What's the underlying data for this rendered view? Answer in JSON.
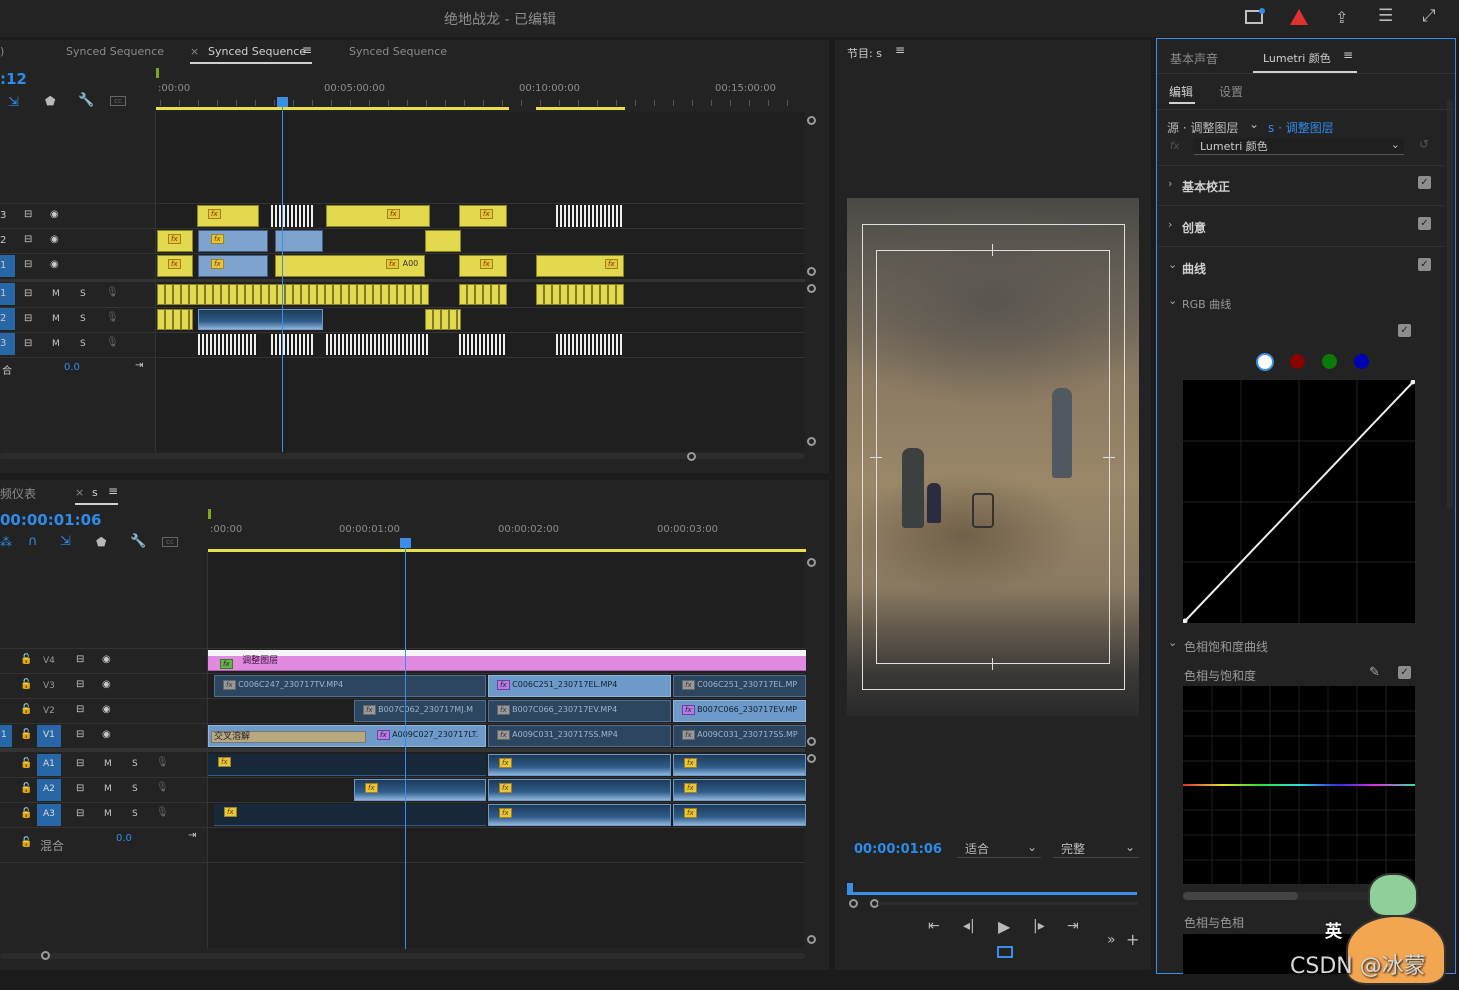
{
  "window": {
    "title": "绝地战龙 - 已编辑"
  },
  "source_panel": {
    "tabs": [
      ")",
      "Synced Sequence",
      "Synced Sequence",
      "Synced Sequence"
    ],
    "timecode": ":12",
    "ruler": [
      ":00:00",
      "00:05:00:00",
      "00:10:00:00",
      "00:15:00:00"
    ],
    "video_tracks": [
      "3",
      "2",
      "1"
    ],
    "audio_tracks": [
      "1",
      "2",
      "3"
    ],
    "mix_label": "合",
    "mix_value": "0.0",
    "clip_label": "A00"
  },
  "timeline": {
    "tab_left": "频仪表",
    "tab_seq": "s",
    "timecode": "00:00:01:06",
    "ruler": [
      ":00:00",
      "00:00:01:00",
      "00:00:02:00",
      "00:00:03:00"
    ],
    "video_tracks": [
      "V4",
      "V3",
      "V2",
      "V1"
    ],
    "audio_tracks": [
      "A1",
      "A2",
      "A3"
    ],
    "mix_label": "混合",
    "mix_value": "0.0",
    "track_m": "M",
    "track_s": "S",
    "v1_target": "1",
    "clips": {
      "adjustment": "调整图层",
      "v3a": "C006C247_230717TV.MP4",
      "v3b": "C006C251_230717EL.MP4",
      "v3c": "C006C251_230717EL.MP",
      "v2a": "B007C062_230717MJ.M",
      "v2b": "B007C066_230717EV.MP4",
      "v2c": "B007C066_230717EV.MP",
      "v1trans": "交叉溶解",
      "v1a": "A009C027_230717LT.",
      "v1b": "A009C031_230717SS.MP4",
      "v1c": "A009C031_230717SS.MP"
    }
  },
  "program": {
    "title": "节目: s",
    "timecode": "00:00:01:06",
    "fit": "适合",
    "quality": "完整"
  },
  "lumetri": {
    "tabs": [
      "基本声音",
      "Lumetri 颜色"
    ],
    "subtabs": [
      "编辑",
      "设置"
    ],
    "source": "源 · 调整图层",
    "target": "s · 调整图层",
    "effect": "Lumetri 颜色",
    "sections": [
      "基本校正",
      "创意",
      "曲线"
    ],
    "rgb_curves": "RGB 曲线",
    "hue_sat_curves": "色相饱和度曲线",
    "hue_vs_sat": "色相与饱和度",
    "hue_vs_hue": "色相与色相",
    "channel_colors": [
      "#ffffff",
      "#8b0000",
      "#0a7a0a",
      "#0000b4"
    ]
  },
  "watermark": "CSDN @冰蒙",
  "badge_char": "英"
}
